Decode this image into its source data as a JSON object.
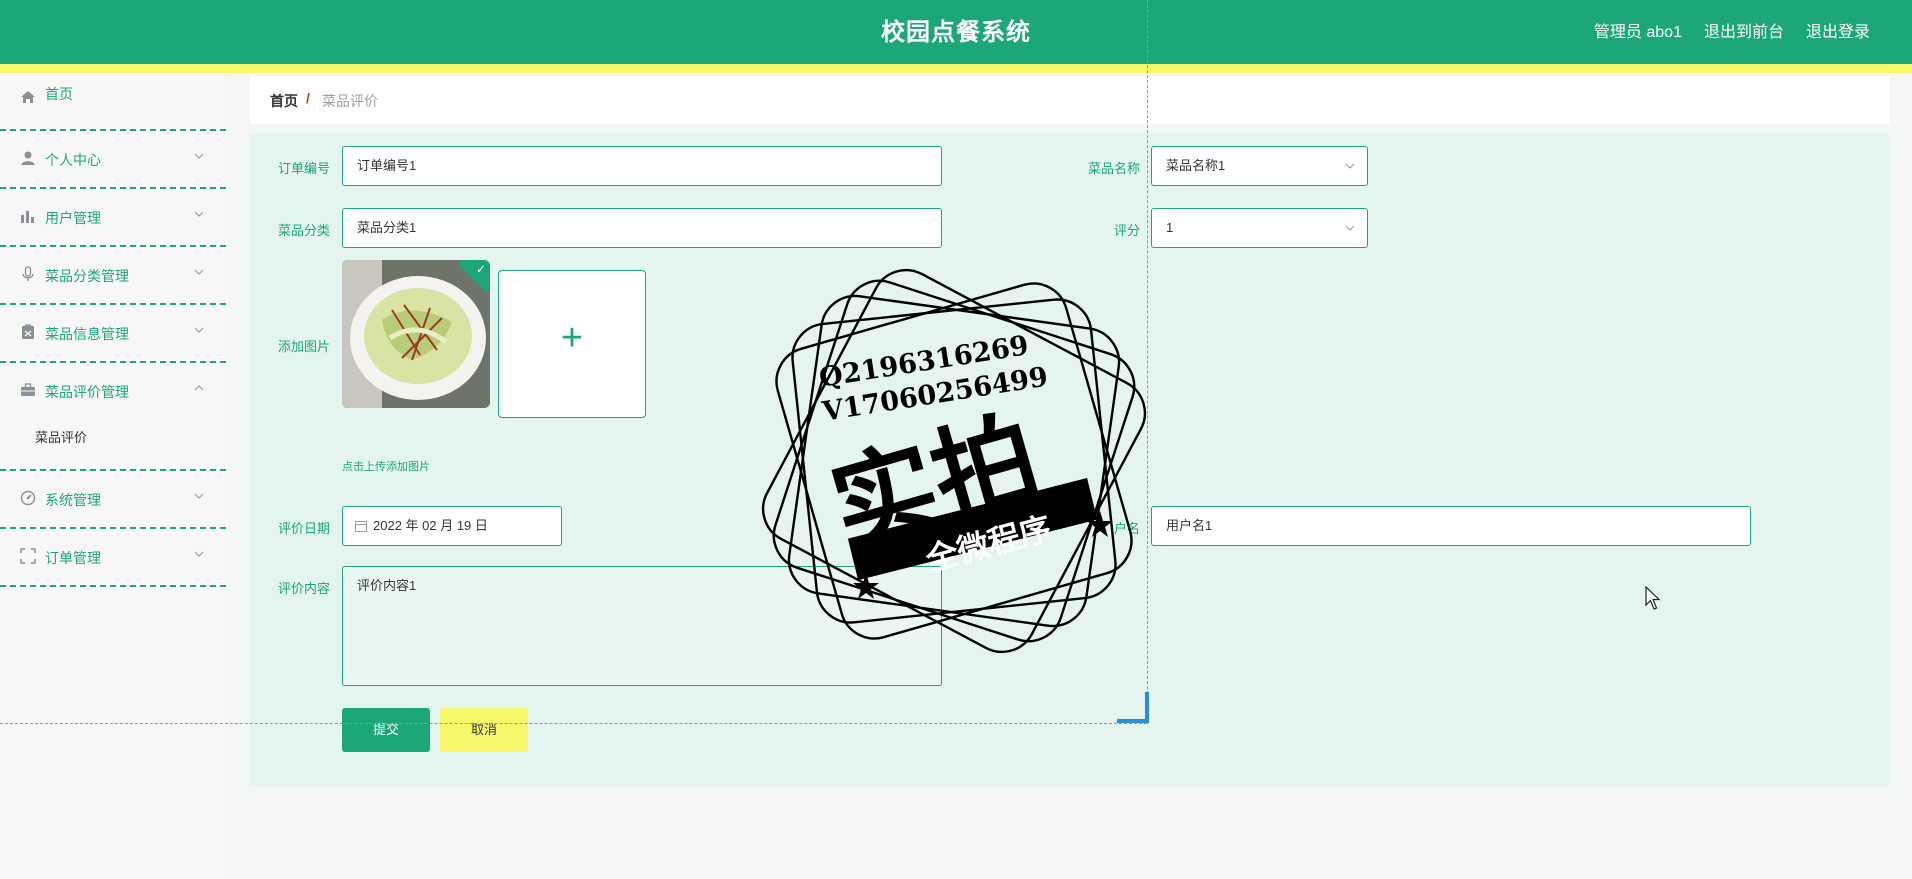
{
  "header": {
    "title": "校园点餐系统",
    "user_label": "管理员 abo1",
    "front_link": "退出到前台",
    "logout_link": "退出登录"
  },
  "sidebar": {
    "items": [
      {
        "label": "首页",
        "icon": "home-icon"
      },
      {
        "label": "个人中心",
        "icon": "user-icon"
      },
      {
        "label": "用户管理",
        "icon": "bar-chart-icon"
      },
      {
        "label": "菜品分类管理",
        "icon": "microphone-icon"
      },
      {
        "label": "菜品信息管理",
        "icon": "clipboard-icon"
      },
      {
        "label": "菜品评价管理",
        "icon": "briefcase-icon"
      },
      {
        "label": "系统管理",
        "icon": "gauge-icon"
      },
      {
        "label": "订单管理",
        "icon": "fullscreen-icon"
      }
    ],
    "submenu": {
      "label": "菜品评价"
    }
  },
  "breadcrumb": {
    "home": "首页",
    "separator": "/",
    "current": "菜品评价"
  },
  "form": {
    "order_no": {
      "label": "订单编号",
      "value": "订单编号1"
    },
    "dish_name": {
      "label": "菜品名称",
      "value": "菜品名称1"
    },
    "dish_category": {
      "label": "菜品分类",
      "value": "菜品分类1"
    },
    "rating": {
      "label": "评分",
      "value": "1"
    },
    "image": {
      "label": "添加图片",
      "add_symbol": "+",
      "tip": "点击上传添加图片"
    },
    "review_date": {
      "label": "评价日期",
      "value": "2022 年 02 月 19 日"
    },
    "username": {
      "label": "户名",
      "value": "用户名1"
    },
    "review_content": {
      "label": "评价内容",
      "value": "评价内容1"
    },
    "submit_label": "提交",
    "cancel_label": "取消"
  },
  "watermark": {
    "line1": "Q2196316269",
    "line2": "V17060256499",
    "main": "实拍",
    "banner": "全微程序"
  },
  "colors": {
    "primary": "#1ca679",
    "accent_yellow": "#f6f86a",
    "panel_bg": "#e4f4ee"
  }
}
